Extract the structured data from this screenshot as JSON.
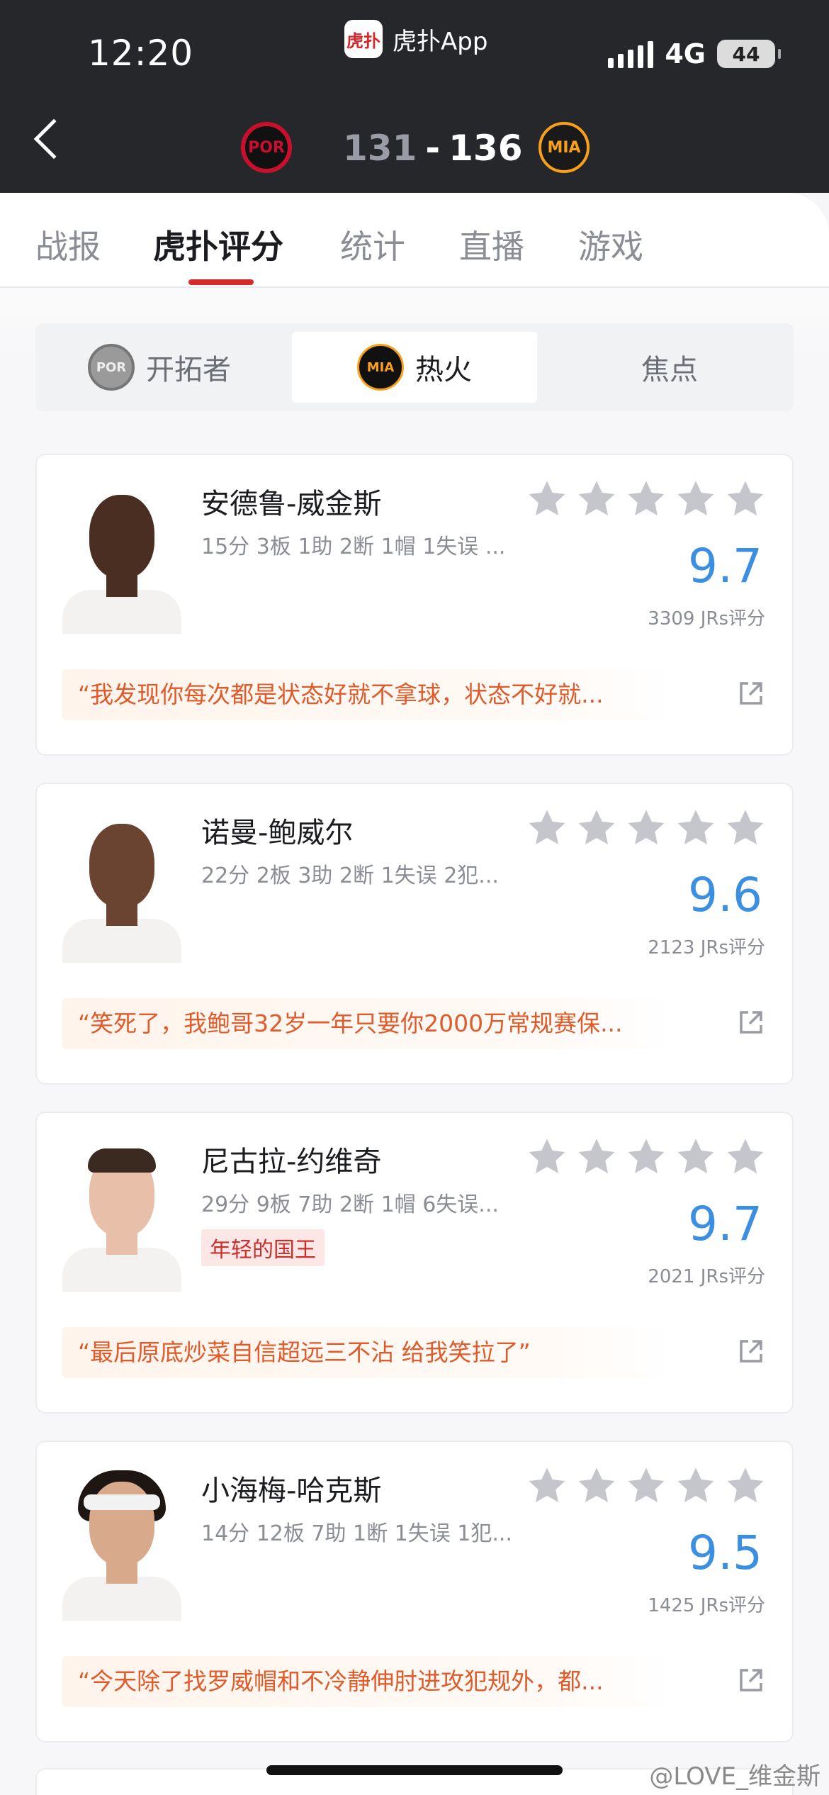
{
  "status": {
    "time": "12:20",
    "network": "4G",
    "battery": "44"
  },
  "app": {
    "logo_text": "虎扑",
    "name": "虎扑App"
  },
  "game": {
    "away_abbr": "POR",
    "home_abbr": "MIA",
    "away_score": "131",
    "separator": "-",
    "home_score": "136"
  },
  "tabs": [
    {
      "label": "战报"
    },
    {
      "label": "虎扑评分"
    },
    {
      "label": "统计"
    },
    {
      "label": "直播"
    },
    {
      "label": "游戏"
    }
  ],
  "segment": [
    {
      "label": "开拓者",
      "logo": "POR"
    },
    {
      "label": "热火",
      "logo": "MIA"
    },
    {
      "label": "焦点"
    }
  ],
  "players": [
    {
      "name": "安德鲁-威金斯",
      "stats": "15分 3板 1助 2断 1帽 1失误 ...",
      "rating": "9.7",
      "votes": "3309 JRs评分",
      "quote": "“我发现你每次都是状态好就不拿球，状态不好就...",
      "badge": ""
    },
    {
      "name": "诺曼-鲍威尔",
      "stats": "22分 2板 3助 2断 1失误 2犯...",
      "rating": "9.6",
      "votes": "2123 JRs评分",
      "quote": "“笑死了，我鲍哥32岁一年只要你2000万常规赛保...",
      "badge": ""
    },
    {
      "name": "尼古拉-约维奇",
      "stats": "29分 9板 7助 2断 1帽 6失误...",
      "rating": "9.7",
      "votes": "2021 JRs评分",
      "quote": "“最后原底炒菜自信超远三不沾 给我笑拉了”",
      "badge": "年轻的国王"
    },
    {
      "name": "小海梅-哈克斯",
      "stats": "14分 12板 7助 1断 1失误 1犯...",
      "rating": "9.5",
      "votes": "1425 JRs评分",
      "quote": "“今天除了找罗威帽和不冷静伸肘进攻犯规外，都...",
      "badge": ""
    }
  ],
  "watermark": "@LOVE_维金斯",
  "colors": {
    "accent_red": "#d62b2b",
    "rating_blue": "#3b8fe0",
    "quote_orange": "#e05a2a",
    "star_grey": "#c4c6cc"
  }
}
